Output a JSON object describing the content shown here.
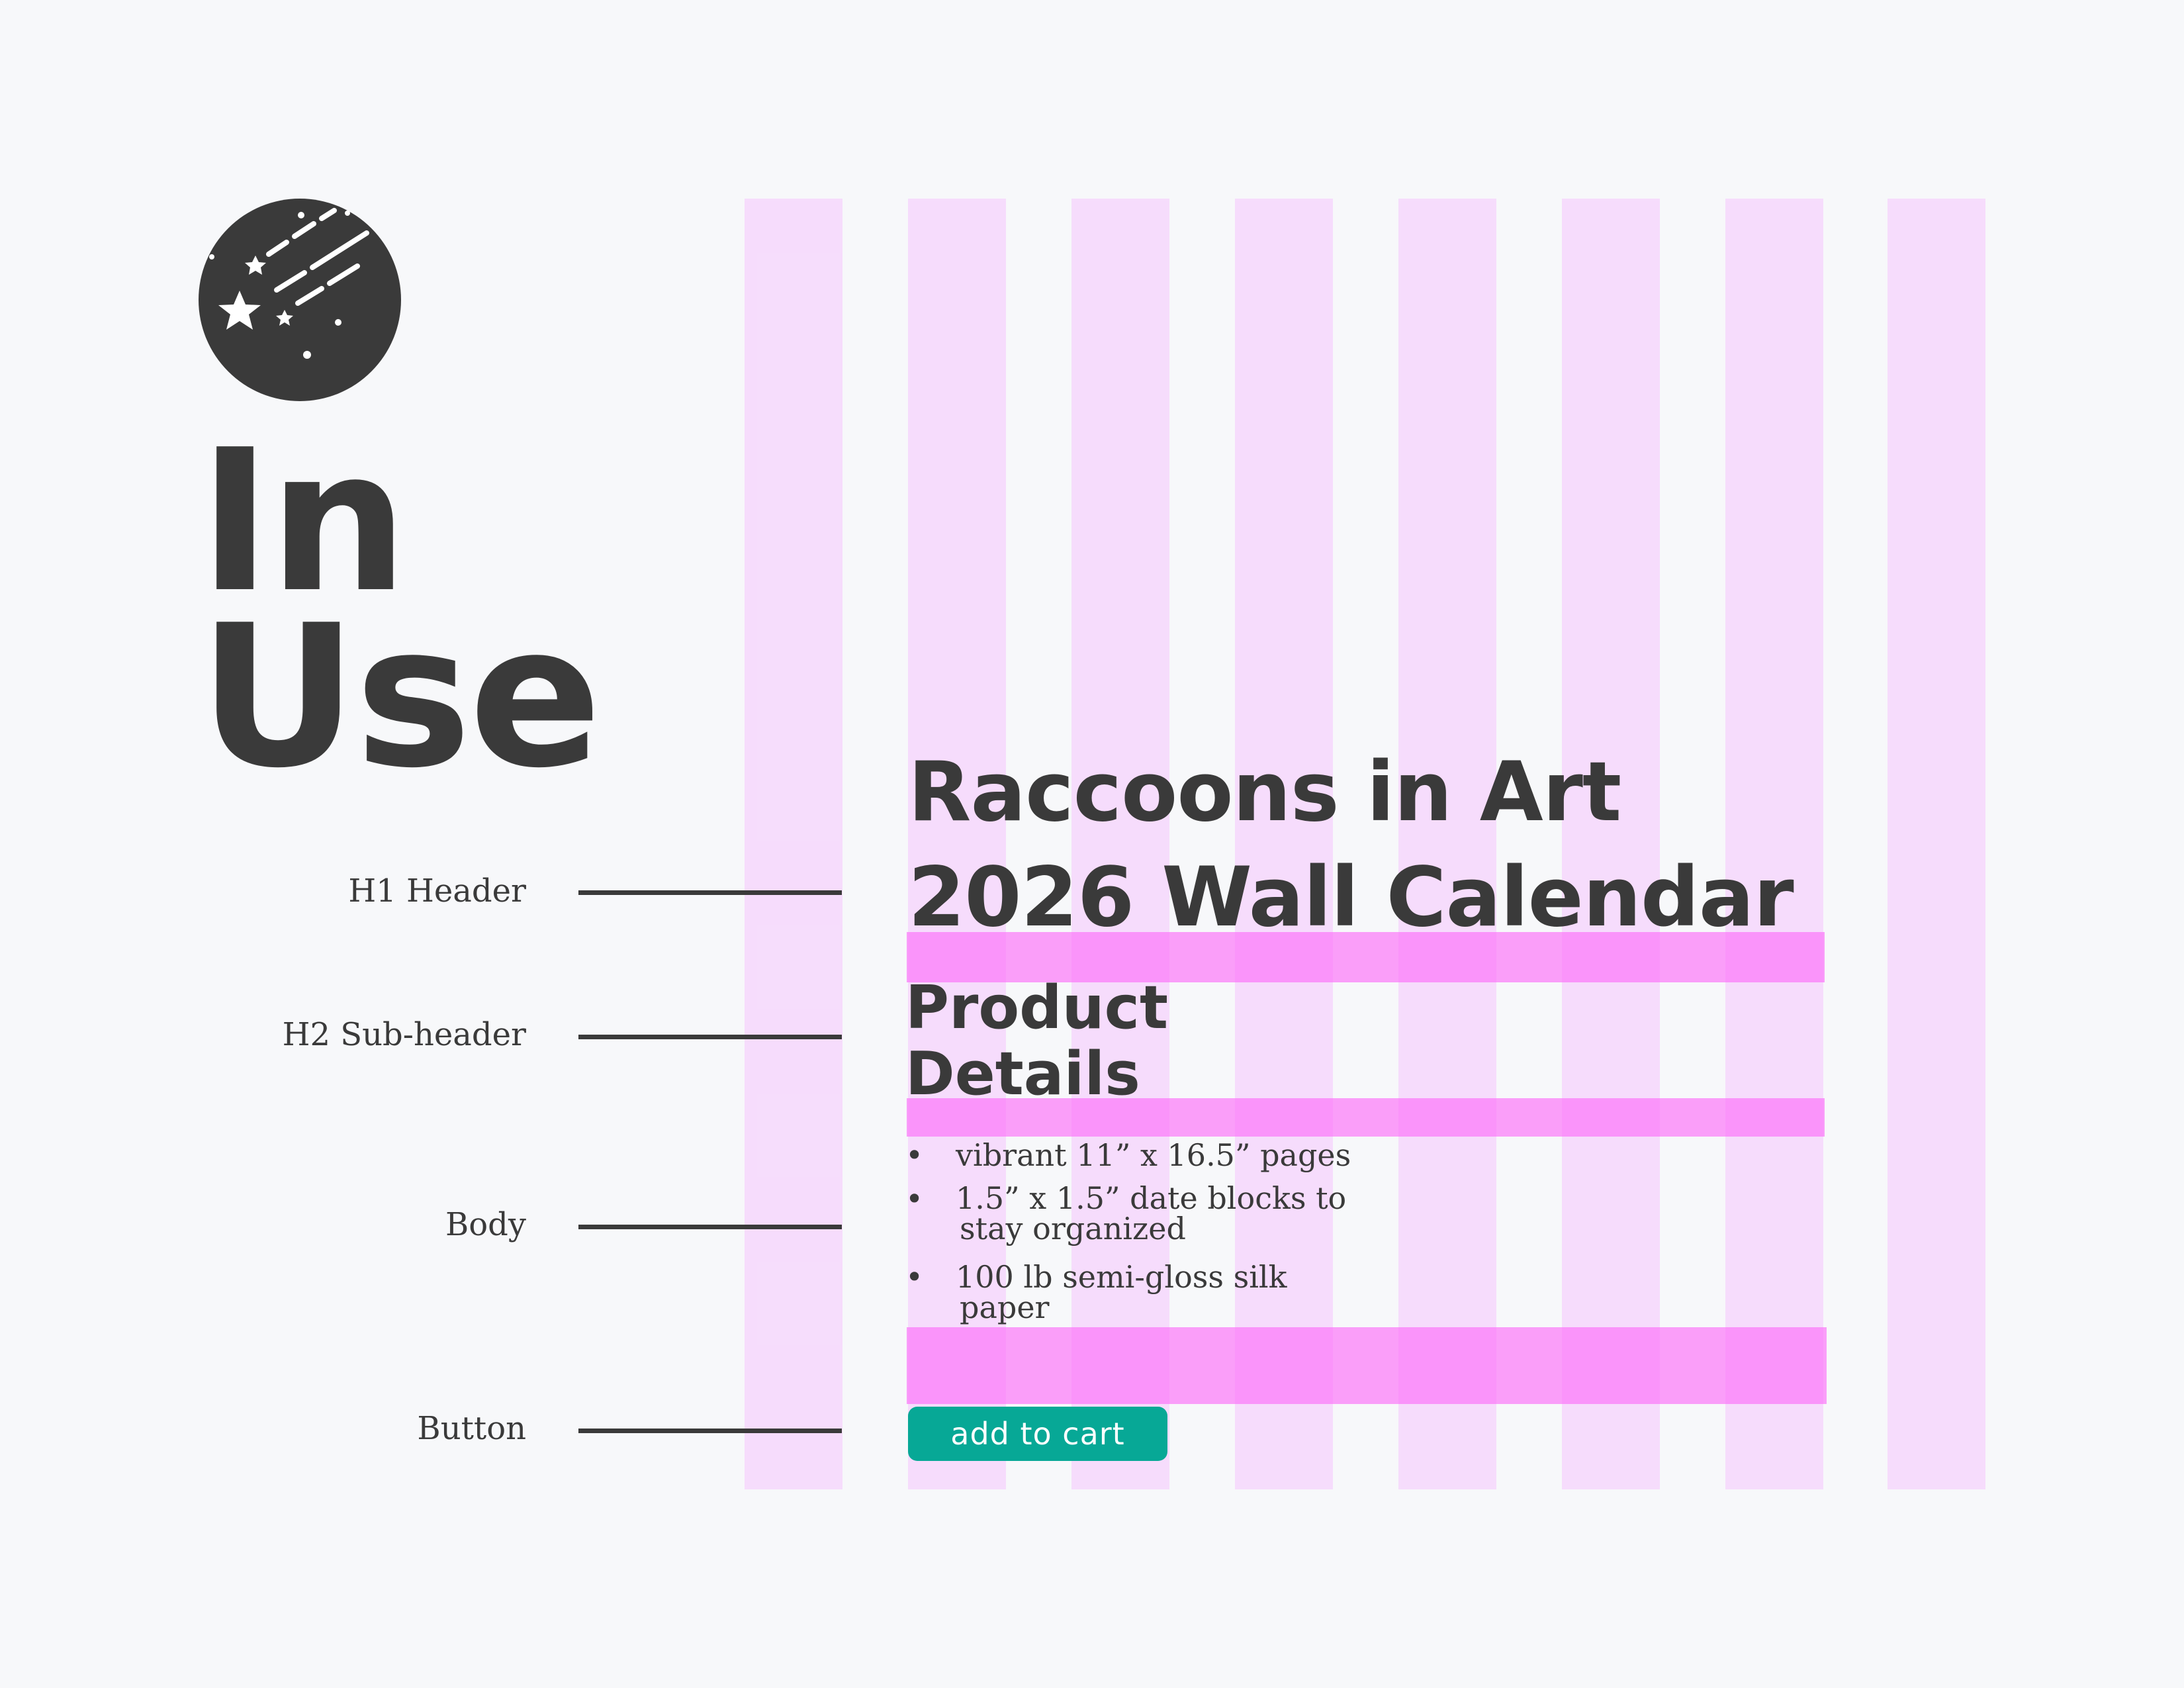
{
  "title": {
    "line1": "In",
    "line2": "Use"
  },
  "annotations": {
    "h1": "H1 Header",
    "h2": "H2 Sub-header",
    "body": "Body",
    "button": "Button"
  },
  "mockup": {
    "h1": {
      "line1": "Raccoons in Art",
      "line2": "2026 Wall Calendar"
    },
    "h2": {
      "line1": "Product",
      "line2": "Details"
    },
    "bullets": [
      {
        "line1": "vibrant 11” x 16.5” pages"
      },
      {
        "line1": "1.5” x 1.5” date blocks to",
        "line2": "stay organized"
      },
      {
        "line1": "100 lb semi-gloss silk",
        "line2": "paper"
      }
    ],
    "bullet_glyph": "•",
    "button_label": "add to cart"
  },
  "colors": {
    "background": "#f7f8fa",
    "text": "#3a3a3a",
    "grid_column": "#f4aaff",
    "spacing_band": "#fc68f8",
    "button": "#07a896",
    "button_text": "#ffffff"
  },
  "icons": {
    "logo": "shooting-stars-icon"
  }
}
